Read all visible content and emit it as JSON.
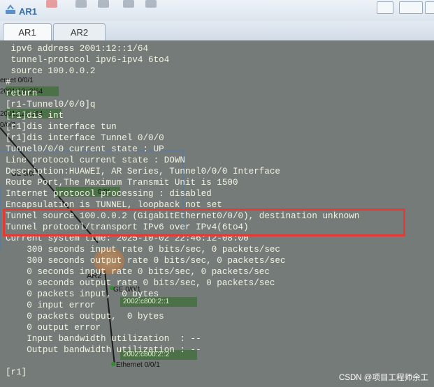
{
  "window": {
    "title": "AR1"
  },
  "tabs": [
    {
      "label": "AR1",
      "active": true
    },
    {
      "label": "AR2",
      "active": false
    }
  ],
  "terminal": {
    "lines": [
      " ipv6 address 2001:12::1/64",
      " tunnel-protocol ipv6-ipv4 6to4",
      " source 100.0.0.2",
      "#",
      "return",
      "[r1-Tunnel0/0/0]q",
      "[r1]dis int",
      "[r1]dis interface tun",
      "[r1]dis interface Tunnel 0/0/0",
      "Tunnel0/0/0 current state : UP",
      "Line protocol current state : DOWN",
      "Description:HUAWEI, AR Series, Tunnel0/0/0 Interface",
      "Route Port,The Maximum Transmit Unit is 1500",
      "Internet protocol processing : disabled",
      "Encapsulation is TUNNEL, loopback not set",
      "Tunnel source 100.0.0.2 (GigabitEthernet0/0/0), destination unknown",
      "Tunnel protocol/transport IPv6 over IPv4(6to4)",
      "Current system time: 2025-10-02 22:46:12-08:00",
      "    300 seconds input rate 0 bits/sec, 0 packets/sec",
      "    300 seconds output rate 0 bits/sec, 0 packets/sec",
      "    0 seconds input rate 0 bits/sec, 0 packets/sec",
      "    0 seconds output rate 0 bits/sec, 0 packets/sec",
      "    0 packets input,  0 bytes",
      "    0 input error",
      "    0 packets output,  0 bytes",
      "    0 output error",
      "    Input bandwidth utilization  : --",
      "    Output bandwidth utilization : --",
      "",
      "[r1]"
    ]
  },
  "background_topology": {
    "labels": {
      "eth_a": "ernet 0/0/1",
      "addr_a": "2001:12::2/64",
      "addr_b": "2001:12::1/64",
      "port_a": "0/0/2",
      "ge_a": "GE 0/0/",
      "ge_b": "0/0/",
      "node": "AR2",
      "ge_c": "GE 0/0/1",
      "addr_c": "2002:c800:2::1",
      "addr_d": "2002:c800:2::2",
      "eth_b": "Ethernet 0/0/1"
    }
  },
  "watermark": "CSDN @项目工程师余工",
  "colors": {
    "terminal_bg": "#757b79",
    "terminal_text": "#f2f4e4",
    "highlight_border": "#e53b36",
    "tab_active": "#f7f9fb",
    "chip_green": "#3f6e3a"
  },
  "icons": {
    "app": "network-device-icon"
  }
}
